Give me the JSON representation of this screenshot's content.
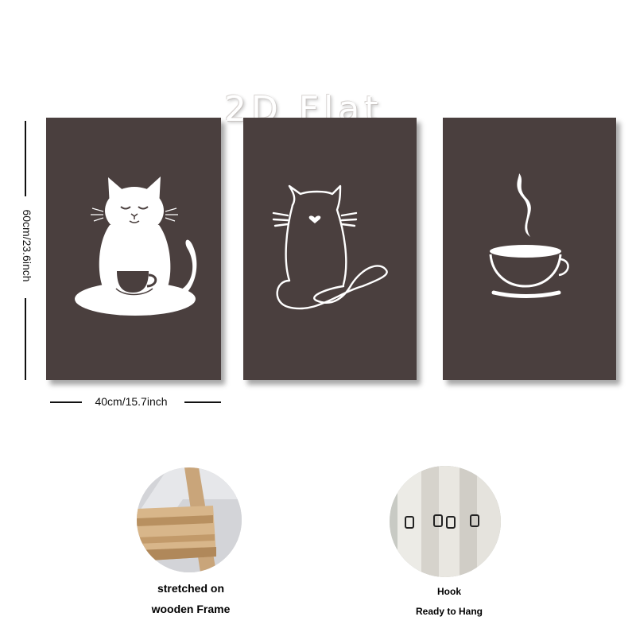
{
  "watermark": "2D Flat",
  "dimensions": {
    "height_label": "60cm/23.6inch",
    "width_label": "40cm/15.7inch"
  },
  "panels": [
    {
      "subject": "meditating-cat-with-coffee-cup"
    },
    {
      "subject": "line-art-cat-back-with-heart"
    },
    {
      "subject": "steaming-coffee-cup"
    }
  ],
  "features": {
    "frame": {
      "line1": "stretched on",
      "line2": "wooden Frame"
    },
    "hook": {
      "line1": "Hook",
      "line2": "Ready to Hang"
    }
  },
  "colors": {
    "panel_background": "#4a3f3e",
    "artwork": "#ffffff"
  }
}
